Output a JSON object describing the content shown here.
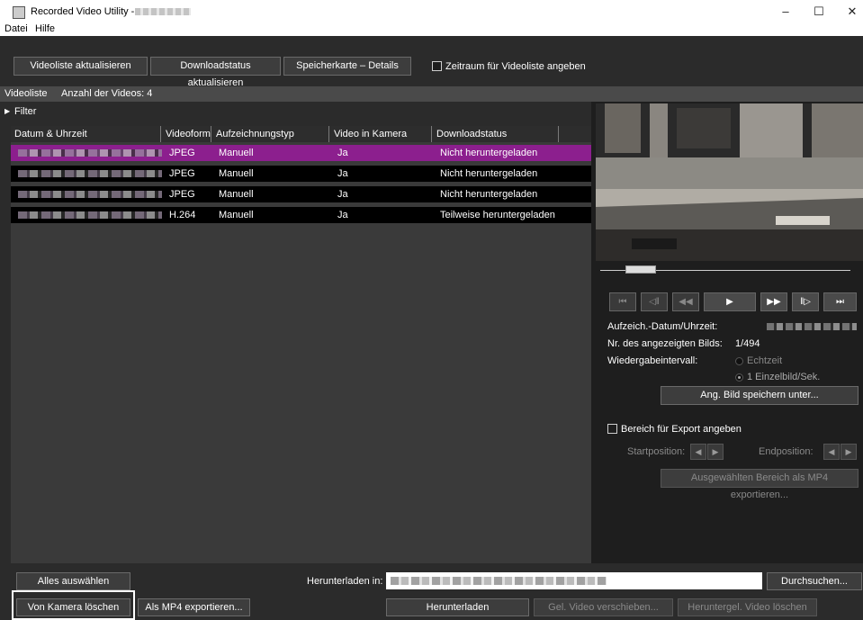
{
  "window": {
    "title": "Recorded Video Utility -",
    "minimize": "–",
    "maximize": "☐",
    "close": "✕"
  },
  "menu": [
    "Datei",
    "Hilfe"
  ],
  "toolbar": {
    "refresh_list": "Videoliste aktualisieren",
    "refresh_download": "Downloadstatus aktualisieren",
    "sdcard_details": "Speicherkarte – Details",
    "period_checkbox": "Zeitraum für Videoliste angeben"
  },
  "list": {
    "header_label": "Videoliste",
    "count_label": "Anzahl der Videos: 4",
    "filter": "Filter",
    "columns": [
      "Datum & Uhrzeit",
      "Videoform",
      "Aufzeichnungstyp",
      "Video in Kamera",
      "Downloadstatus"
    ],
    "rows": [
      {
        "format": "JPEG",
        "type": "Manuell",
        "in_camera": "Ja",
        "status": "Nicht heruntergeladen",
        "selected": true
      },
      {
        "format": "JPEG",
        "type": "Manuell",
        "in_camera": "Ja",
        "status": "Nicht heruntergeladen",
        "selected": false
      },
      {
        "format": "JPEG",
        "type": "Manuell",
        "in_camera": "Ja",
        "status": "Nicht heruntergeladen",
        "selected": false
      },
      {
        "format": "H.264",
        "type": "Manuell",
        "in_camera": "Ja",
        "status": "Teilweise heruntergeladen",
        "selected": false
      }
    ]
  },
  "player": {
    "seek_position": 0.1,
    "controls": [
      "⏮",
      "◁‖",
      "◀◀",
      "▶",
      "▶▶",
      "‖▷",
      "⏭"
    ],
    "rec_datetime_label": "Aufzeich.-Datum/Uhrzeit:",
    "frame_no_label": "Nr. des angezeigten Bilds:",
    "frame_no_value": "1/494",
    "interval_label": "Wiedergabeintervall:",
    "interval_opt_realtime": "Echtzeit",
    "interval_opt_one": "1 Einzelbild/Sek.",
    "save_image": "Ang. Bild speichern unter...",
    "export_range_checkbox": "Bereich für Export angeben",
    "start_label": "Startposition:",
    "end_label": "Endposition:",
    "export_selected": "Ausgewählten Bereich als MP4 exportieren..."
  },
  "bottom": {
    "select_all": "Alles auswählen",
    "download_to_label": "Herunterladen in:",
    "browse": "Durchsuchen...",
    "delete_from_camera": "Von Kamera löschen",
    "export_mp4": "Als MP4 exportieren...",
    "download": "Herunterladen",
    "move_video": "Gel. Video verschieben...",
    "delete_downloaded": "Heruntergel. Video löschen"
  },
  "colors": {
    "selection": "#8c1f8e",
    "background": "#2b2b2b",
    "panel": "#1e1e1e"
  }
}
